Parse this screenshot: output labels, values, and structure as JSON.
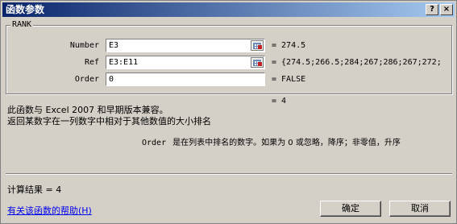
{
  "window": {
    "title": "函数参数",
    "help_button": "?",
    "close_button": "×"
  },
  "function_group": {
    "name": "RANK",
    "args": [
      {
        "label": "Number",
        "value": "E3",
        "result": "= 274.5"
      },
      {
        "label": "Ref",
        "value": "E3:E11",
        "result": "= {274.5;266.5;284;267;286;267;272;"
      },
      {
        "label": "Order",
        "value": "0",
        "result": "= FALSE"
      }
    ]
  },
  "function_result": "= 4",
  "description": {
    "compat": "此函数与 Excel 2007 和早期版本兼容。",
    "summary": "返回某数字在一列数字中相对于其他数值的大小排名",
    "param_name": "Order",
    "param_text": "是在列表中排名的数字。如果为 0 或忽略，降序；非零值，升序"
  },
  "calc_result": "计算结果 =  4",
  "help_link": "有关该函数的帮助(H)",
  "buttons": {
    "ok": "确定",
    "cancel": "取消"
  }
}
